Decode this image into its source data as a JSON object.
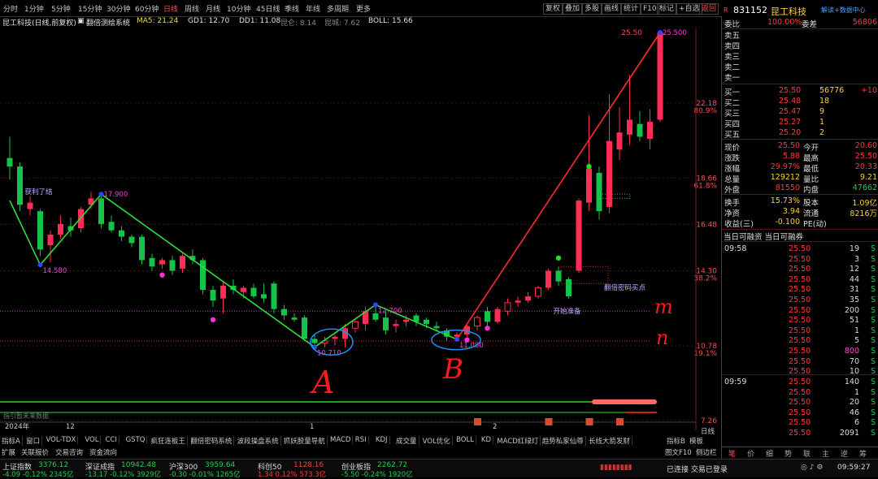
{
  "topbar": {
    "periods": [
      "分时",
      "1分钟",
      "5分钟",
      "15分钟",
      "30分钟",
      "60分钟",
      "日线",
      "周线",
      "月线",
      "10分钟",
      "45日线",
      "季线",
      "年线",
      "多周期",
      "更多"
    ],
    "active_period": "日线",
    "right_buttons": [
      "复权",
      "叠加",
      "多股",
      "画线",
      "统计",
      "F10",
      "标记",
      "+自选",
      "返回"
    ]
  },
  "info": {
    "title": "昆工科技(日线,前复权)",
    "indicator_name": "翻倍测绘系统",
    "ma5": "MA5: 21.24",
    "gd1": "GD1: 12.70",
    "dd1": "DD1: 11.08",
    "x1": "昆仑: 8.14",
    "x2": "昆城: 7.62",
    "boll": "BOLL: 15.66"
  },
  "chart_data": {
    "type": "candlestick",
    "y_axis": {
      "min": 7.26,
      "max": 25.5
    },
    "price_labels": [
      {
        "value": "22.18",
        "pct": "80.9%",
        "y": 22.18
      },
      {
        "value": "18.66",
        "pct": "61.8%",
        "y": 18.66
      },
      {
        "value": "16.48",
        "pct": "",
        "y": 16.48
      },
      {
        "value": "14.30",
        "pct": "38.2%",
        "y": 14.3
      },
      {
        "value": "10.78",
        "pct": "19.1%",
        "y": 10.78
      },
      {
        "value": "7.26",
        "pct": "",
        "y": 7.26
      }
    ],
    "x_labels": [
      {
        "text": "2024年",
        "i": 0
      },
      {
        "text": "12",
        "i": 6
      },
      {
        "text": "1",
        "i": 30
      },
      {
        "text": "2",
        "i": 48
      }
    ],
    "candles": [
      {
        "o": 19.6,
        "h": 20.6,
        "l": 18.6,
        "c": 19.2
      },
      {
        "o": 19.2,
        "h": 19.4,
        "l": 17.1,
        "c": 17.4
      },
      {
        "o": 17.2,
        "h": 17.8,
        "l": 16.9,
        "c": 17.5
      },
      {
        "o": 17.1,
        "h": 17.2,
        "l": 15.0,
        "c": 15.3
      },
      {
        "o": 15.5,
        "h": 16.2,
        "l": 14.7,
        "c": 16.0
      },
      {
        "o": 16.0,
        "h": 16.9,
        "l": 15.8,
        "c": 16.5
      },
      {
        "o": 16.4,
        "h": 16.8,
        "l": 15.9,
        "c": 16.2
      },
      {
        "o": 16.3,
        "h": 17.3,
        "l": 16.1,
        "c": 17.2
      },
      {
        "o": 17.4,
        "h": 18.0,
        "l": 17.2,
        "c": 17.7
      },
      {
        "o": 17.7,
        "h": 17.8,
        "l": 16.3,
        "c": 16.5
      },
      {
        "o": 16.6,
        "h": 16.9,
        "l": 16.1,
        "c": 16.2
      },
      {
        "o": 16.2,
        "h": 16.4,
        "l": 15.7,
        "c": 15.9
      },
      {
        "o": 15.9,
        "h": 16.0,
        "l": 15.4,
        "c": 15.6
      },
      {
        "o": 15.9,
        "h": 16.0,
        "l": 14.6,
        "c": 14.8
      },
      {
        "o": 14.9,
        "h": 15.1,
        "l": 14.3,
        "c": 14.5
      },
      {
        "o": 14.6,
        "h": 14.9,
        "l": 14.4,
        "c": 14.8
      },
      {
        "o": 14.8,
        "h": 15.0,
        "l": 14.1,
        "c": 14.3
      },
      {
        "o": 14.4,
        "h": 15.1,
        "l": 14.2,
        "c": 15.0
      },
      {
        "o": 15.0,
        "h": 15.3,
        "l": 14.6,
        "c": 14.8
      },
      {
        "o": 14.8,
        "h": 14.9,
        "l": 13.2,
        "c": 13.4
      },
      {
        "o": 13.4,
        "h": 13.6,
        "l": 12.6,
        "c": 12.9
      },
      {
        "o": 13.0,
        "h": 13.8,
        "l": 12.3,
        "c": 13.6
      },
      {
        "o": 13.6,
        "h": 13.9,
        "l": 13.2,
        "c": 13.4
      },
      {
        "o": 13.3,
        "h": 13.6,
        "l": 13.0,
        "c": 13.5
      },
      {
        "o": 13.5,
        "h": 13.7,
        "l": 13.0,
        "c": 13.1
      },
      {
        "o": 13.2,
        "h": 13.7,
        "l": 12.8,
        "c": 13.0
      },
      {
        "o": 13.7,
        "h": 13.8,
        "l": 12.3,
        "c": 12.5
      },
      {
        "o": 12.5,
        "h": 12.7,
        "l": 12.0,
        "c": 12.2
      },
      {
        "o": 12.1,
        "h": 12.3,
        "l": 11.9,
        "c": 12.0
      },
      {
        "o": 12.1,
        "h": 12.2,
        "l": 11.0,
        "c": 11.1
      },
      {
        "o": 11.1,
        "h": 11.3,
        "l": 10.7,
        "c": 10.9
      },
      {
        "o": 10.9,
        "h": 11.2,
        "l": 10.7,
        "c": 11.0
      },
      {
        "o": 11.1,
        "h": 11.3,
        "l": 10.8,
        "c": 11.2
      },
      {
        "o": 11.1,
        "h": 11.8,
        "l": 10.7,
        "c": 11.6
      },
      {
        "o": 11.6,
        "h": 12.0,
        "l": 11.4,
        "c": 11.9
      },
      {
        "o": 11.8,
        "h": 12.6,
        "l": 11.5,
        "c": 12.4
      },
      {
        "o": 12.3,
        "h": 12.8,
        "l": 11.9,
        "c": 12.0
      },
      {
        "o": 12.1,
        "h": 12.4,
        "l": 11.3,
        "c": 11.5
      },
      {
        "o": 11.7,
        "h": 12.0,
        "l": 11.4,
        "c": 11.8
      },
      {
        "o": 11.9,
        "h": 12.2,
        "l": 11.7,
        "c": 12.0
      },
      {
        "o": 12.2,
        "h": 12.3,
        "l": 11.7,
        "c": 11.9
      },
      {
        "o": 12.0,
        "h": 12.1,
        "l": 11.6,
        "c": 11.8
      },
      {
        "o": 11.7,
        "h": 11.9,
        "l": 11.5,
        "c": 11.6
      },
      {
        "o": 11.5,
        "h": 11.6,
        "l": 11.0,
        "c": 11.2
      },
      {
        "o": 11.2,
        "h": 11.4,
        "l": 11.08,
        "c": 11.3
      },
      {
        "o": 11.3,
        "h": 11.8,
        "l": 11.2,
        "c": 11.7
      },
      {
        "o": 11.7,
        "h": 12.2,
        "l": 11.5,
        "c": 12.1
      },
      {
        "o": 12.4,
        "h": 12.6,
        "l": 11.7,
        "c": 11.9
      },
      {
        "o": 11.9,
        "h": 12.6,
        "l": 11.8,
        "c": 12.5
      },
      {
        "o": 12.4,
        "h": 13.0,
        "l": 12.2,
        "c": 12.8
      },
      {
        "o": 12.8,
        "h": 13.1,
        "l": 12.6,
        "c": 12.9
      },
      {
        "o": 12.9,
        "h": 13.3,
        "l": 12.8,
        "c": 13.1
      },
      {
        "o": 13.1,
        "h": 13.6,
        "l": 13.0,
        "c": 13.5
      },
      {
        "o": 13.5,
        "h": 14.4,
        "l": 13.4,
        "c": 14.3
      },
      {
        "o": 14.3,
        "h": 14.5,
        "l": 13.6,
        "c": 13.8
      },
      {
        "o": 13.9,
        "h": 14.0,
        "l": 13.0,
        "c": 13.1
      },
      {
        "o": 14.3,
        "h": 17.7,
        "l": 14.2,
        "c": 17.6
      },
      {
        "o": 17.5,
        "h": 21.6,
        "l": 17.1,
        "c": 19.1
      },
      {
        "o": 18.9,
        "h": 19.2,
        "l": 16.7,
        "c": 17.1
      },
      {
        "o": 17.3,
        "h": 22.6,
        "l": 17.0,
        "c": 20.4
      },
      {
        "o": 20.0,
        "h": 22.0,
        "l": 19.5,
        "c": 20.8
      },
      {
        "o": 20.7,
        "h": 23.5,
        "l": 20.2,
        "c": 21.4
      },
      {
        "o": 21.2,
        "h": 21.8,
        "l": 20.4,
        "c": 20.6
      },
      {
        "o": 20.5,
        "h": 21.9,
        "l": 20.0,
        "c": 21.3
      },
      {
        "o": 21.4,
        "h": 25.5,
        "l": 21.3,
        "c": 25.5
      }
    ],
    "trend_points": [
      {
        "i": 0,
        "v": 17.6
      },
      {
        "i": 3,
        "v": 14.58
      },
      {
        "i": 9,
        "v": 17.9
      },
      {
        "i": 30,
        "v": 10.71
      },
      {
        "i": 36,
        "v": 12.7
      },
      {
        "i": 44,
        "v": 11.08
      },
      {
        "i": 64,
        "v": 25.5
      }
    ],
    "point_labels": [
      {
        "text": "17.900",
        "i": 9,
        "v": 17.9
      },
      {
        "text": "14.580",
        "i": 3,
        "v": 14.58
      },
      {
        "text": "10.710",
        "i": 30,
        "v": 10.71
      },
      {
        "text": "12.700",
        "i": 36,
        "v": 12.7
      },
      {
        "text": "11.080",
        "i": 44,
        "v": 11.08
      },
      {
        "text": "25.500",
        "i": 64,
        "v": 25.5
      }
    ],
    "annotations": [
      {
        "text": "获利了结",
        "i": 1,
        "v": 17.9
      },
      {
        "text": "翻倍密码买点",
        "i": 58,
        "v": 13.4
      },
      {
        "text": "开始准备",
        "i": 53,
        "v": 12.3
      }
    ],
    "handwritten": [
      "A",
      "B",
      "m",
      "n"
    ]
  },
  "right": {
    "code": "831152",
    "name": "昆工科技",
    "sub": "解读+数据中心",
    "wei_bi_label": "委比",
    "wei_bi": "100.00%",
    "wei_cha_label": "委差",
    "wei_cha": "56806",
    "sells": [
      "卖五",
      "卖四",
      "卖三",
      "卖二",
      "卖一"
    ],
    "buys": [
      {
        "label": "买一",
        "price": "25.50",
        "vol": "56776",
        "chg": "+10"
      },
      {
        "label": "买二",
        "price": "25.48",
        "vol": "18",
        "chg": ""
      },
      {
        "label": "买三",
        "price": "25.47",
        "vol": "9",
        "chg": ""
      },
      {
        "label": "买四",
        "price": "25.27",
        "vol": "1",
        "chg": ""
      },
      {
        "label": "买五",
        "price": "25.20",
        "vol": "2",
        "chg": ""
      }
    ],
    "stats": [
      {
        "l1": "现价",
        "v1": "25.50",
        "l2": "今开",
        "v2": "20.60"
      },
      {
        "l1": "涨跌",
        "v1": "5.88",
        "l2": "最高",
        "v2": "25.50"
      },
      {
        "l1": "涨幅",
        "v1": "29.97%",
        "l2": "最低",
        "v2": "20.33"
      },
      {
        "l1": "总量",
        "v1": "129212",
        "l2": "量比",
        "v2": "9.21"
      },
      {
        "l1": "外盘",
        "v1": "81550",
        "l2": "内盘",
        "v2": "47662"
      }
    ],
    "stats2": [
      {
        "l1": "换手",
        "v1": "15.73%",
        "l2": "股本",
        "v2": "1.09亿"
      },
      {
        "l1": "净资",
        "v1": "3.94",
        "l2": "流通",
        "v2": "8216万"
      },
      {
        "l1": "收益(三)",
        "v1": "-0.100",
        "l2": "PE(动)",
        "v2": ""
      }
    ],
    "margin_tabs": "当日可融资 当日可融券",
    "ticks_time1": "09:58",
    "ticks_time2": "09:59",
    "ticks1": [
      {
        "p": "25.50",
        "v": "19",
        "s": "S"
      },
      {
        "p": "25.50",
        "v": "3",
        "s": "S"
      },
      {
        "p": "25.50",
        "v": "12",
        "s": "S"
      },
      {
        "p": "25.50",
        "v": "44",
        "s": "S"
      },
      {
        "p": "25.50",
        "v": "31",
        "s": "S"
      },
      {
        "p": "25.50",
        "v": "35",
        "s": "S"
      },
      {
        "p": "25.50",
        "v": "200",
        "s": "S"
      },
      {
        "p": "25.50",
        "v": "51",
        "s": "S"
      },
      {
        "p": "25.50",
        "v": "1",
        "s": "S"
      },
      {
        "p": "25.50",
        "v": "5",
        "s": "S"
      },
      {
        "p": "25.50",
        "v": "800",
        "s": "S"
      },
      {
        "p": "25.50",
        "v": "70",
        "s": "S"
      },
      {
        "p": "25.50",
        "v": "10",
        "s": "S"
      }
    ],
    "ticks2": [
      {
        "p": "25.50",
        "v": "140",
        "s": "S"
      },
      {
        "p": "25.50",
        "v": "1",
        "s": "S"
      },
      {
        "p": "25.50",
        "v": "20",
        "s": "S"
      },
      {
        "p": "25.50",
        "v": "46",
        "s": "S"
      },
      {
        "p": "25.50",
        "v": "6",
        "s": "S"
      },
      {
        "p": "25.50",
        "v": "2091",
        "s": "S"
      }
    ],
    "bottom_tabs": [
      "笔",
      "价",
      "细",
      "势",
      "联",
      "主",
      "逆",
      "筹"
    ]
  },
  "bottom": {
    "tabs1": [
      "指标A",
      "窗口",
      "VOL-TDX",
      "VOL",
      "CCI",
      "GSTQ",
      "疯狂连板王",
      "翻倍密码系统",
      "波段操盘系统",
      "抓妖股量导航",
      "MACD",
      "RSI",
      "KDJ",
      "成交量",
      "VOL优化",
      "BOLL",
      "KD",
      "MACD红绿灯",
      "趋势私家仙尊",
      "长线大箭发财"
    ],
    "tabs2": [
      "扩展",
      "关联报价",
      "交易咨询",
      "资金流向"
    ],
    "right_tabs": [
      "指标B",
      "模板"
    ],
    "right_tabs2": [
      "图文F10",
      "侧边栏"
    ],
    "no_data": "指引暂未来数据",
    "day_label": "日线"
  },
  "status": {
    "indices": [
      {
        "name": "上证指数",
        "val": "3376.12",
        "chg": "-4.09",
        "pct": "-0.12%",
        "amt": "2345亿"
      },
      {
        "name": "深证成指",
        "val": "10942.48",
        "chg": "-13.17",
        "pct": "-0.12%",
        "amt": "3929亿"
      },
      {
        "name": "沪深300",
        "val": "3959.64",
        "chg": "-0.30",
        "pct": "-0.01%",
        "amt": "1265亿"
      },
      {
        "name": "科创50",
        "val": "1128.16",
        "chg": "1.34",
        "pct": "0.12%",
        "amt": "573.3亿"
      },
      {
        "name": "创业板指",
        "val": "2262.72",
        "chg": "-5.50",
        "pct": "-0.24%",
        "amt": "1920亿"
      }
    ],
    "connection": "已连接 交易已登录",
    "clock": "09:59:27"
  }
}
